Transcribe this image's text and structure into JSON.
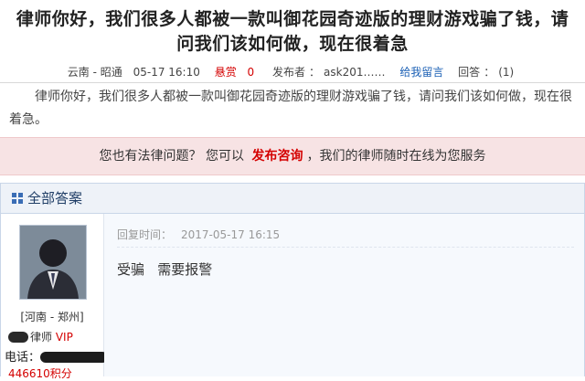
{
  "question": {
    "title": "律师你好，我们很多人都被一款叫御花园奇迹版的理财游戏骗了钱，请问我们该如何做，现在很着急",
    "location": "云南 - 昭通",
    "date": "05-17 16:10",
    "bounty_label": "悬赏",
    "bounty_value": "0",
    "poster_label": "发布者",
    "poster_value": "ask201……",
    "message_link": "给我留言",
    "replies_label": "回答",
    "replies_value": "(1)",
    "body": "律师你好，我们很多人都被一款叫御花园奇迹版的理财游戏骗了钱，请问我们该如何做，现在很着急。"
  },
  "banner": {
    "prefix": "您也有法律问题？ 您可以",
    "cta": "发布咨询",
    "suffix": "，我们的律师随时在线为您服务"
  },
  "answers": {
    "header": "全部答案",
    "header_icon": "grid-icon",
    "items": [
      {
        "location": "[河南 - 郑州]",
        "title": "律师",
        "vip": "VIP",
        "phone_label": "电话：",
        "points": "446610积分",
        "reply_time_label": "回复时间：",
        "reply_time": "2017-05-17 16:15",
        "content": "受骗   需要报警"
      }
    ]
  },
  "colors": {
    "accent_red": "#d40000",
    "link_blue": "#1a5fb4",
    "banner_bg": "#f7e3e4",
    "panel_header_bg": "#eef2f8"
  }
}
